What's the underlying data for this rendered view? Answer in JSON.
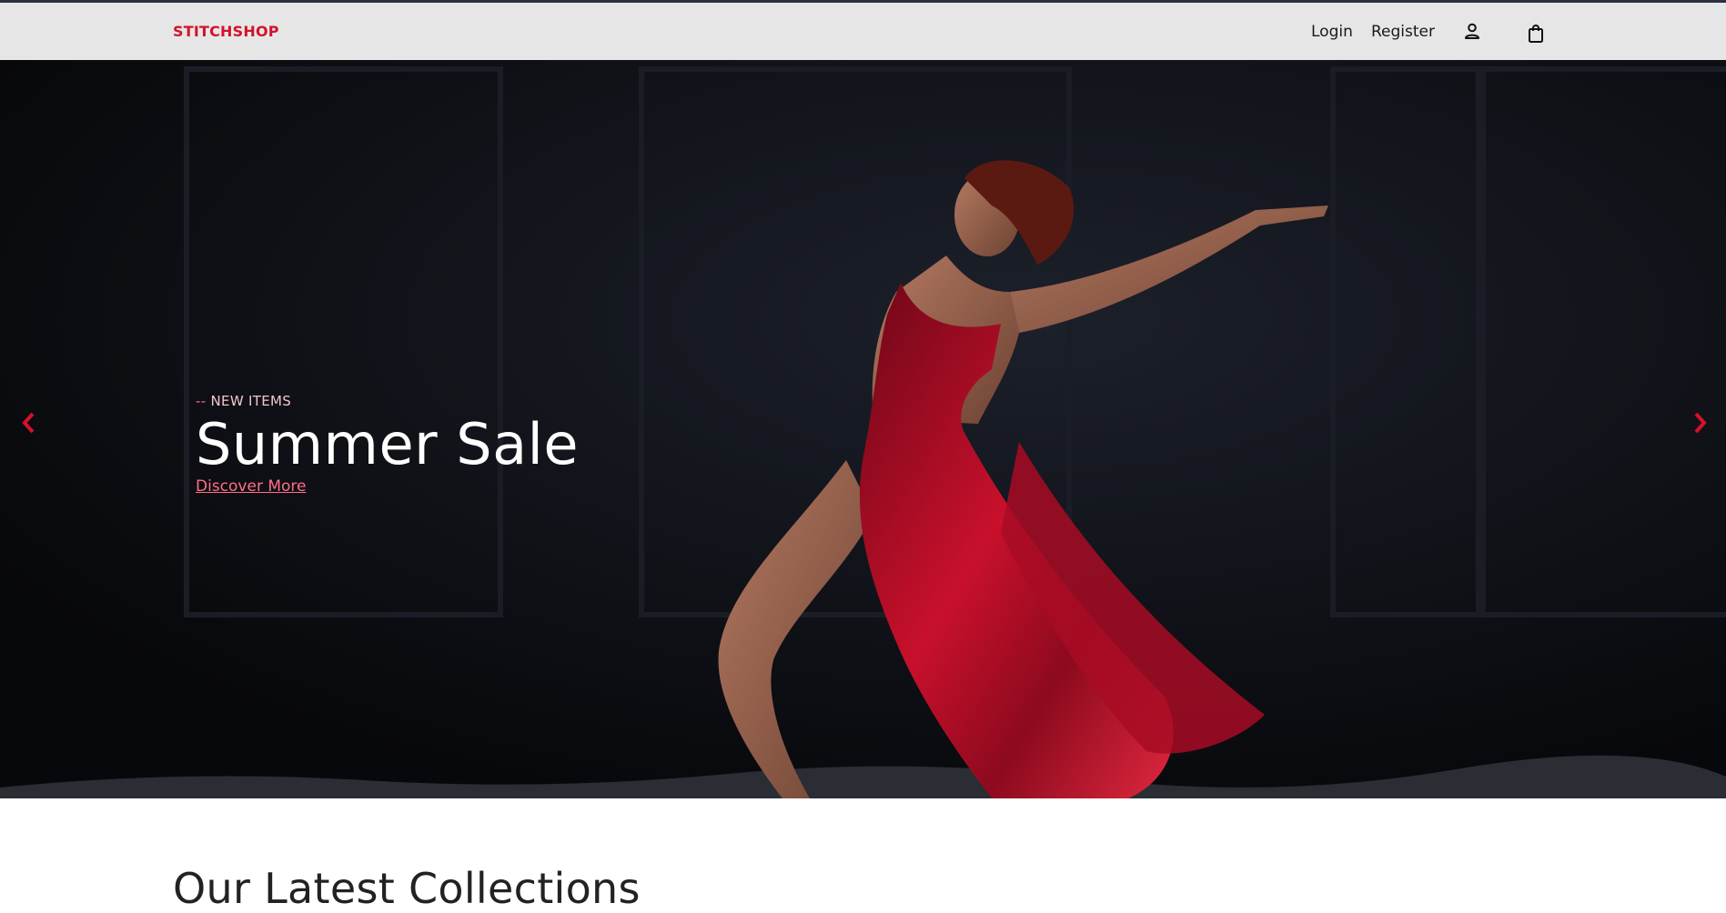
{
  "header": {
    "brand": "STITCHSHOP",
    "nav": {
      "login": "Login",
      "register": "Register"
    },
    "icons": {
      "account": "account-icon",
      "bag": "shopping-bag-icon"
    }
  },
  "hero": {
    "eyebrow_dashes": "--",
    "eyebrow": "NEW ITEMS",
    "title": "Summer Sale",
    "cta": "Discover More",
    "image_description": "dancer-in-red-satin-dress",
    "prev_icon": "chevron-left-icon",
    "next_icon": "chevron-right-icon"
  },
  "collections": {
    "title": "Our Latest Collections"
  },
  "colors": {
    "brand": "#d3122b",
    "accent": "#ff6f82",
    "nav_bg": "#e6e6e6",
    "hero_bg": "#0b0c10"
  }
}
